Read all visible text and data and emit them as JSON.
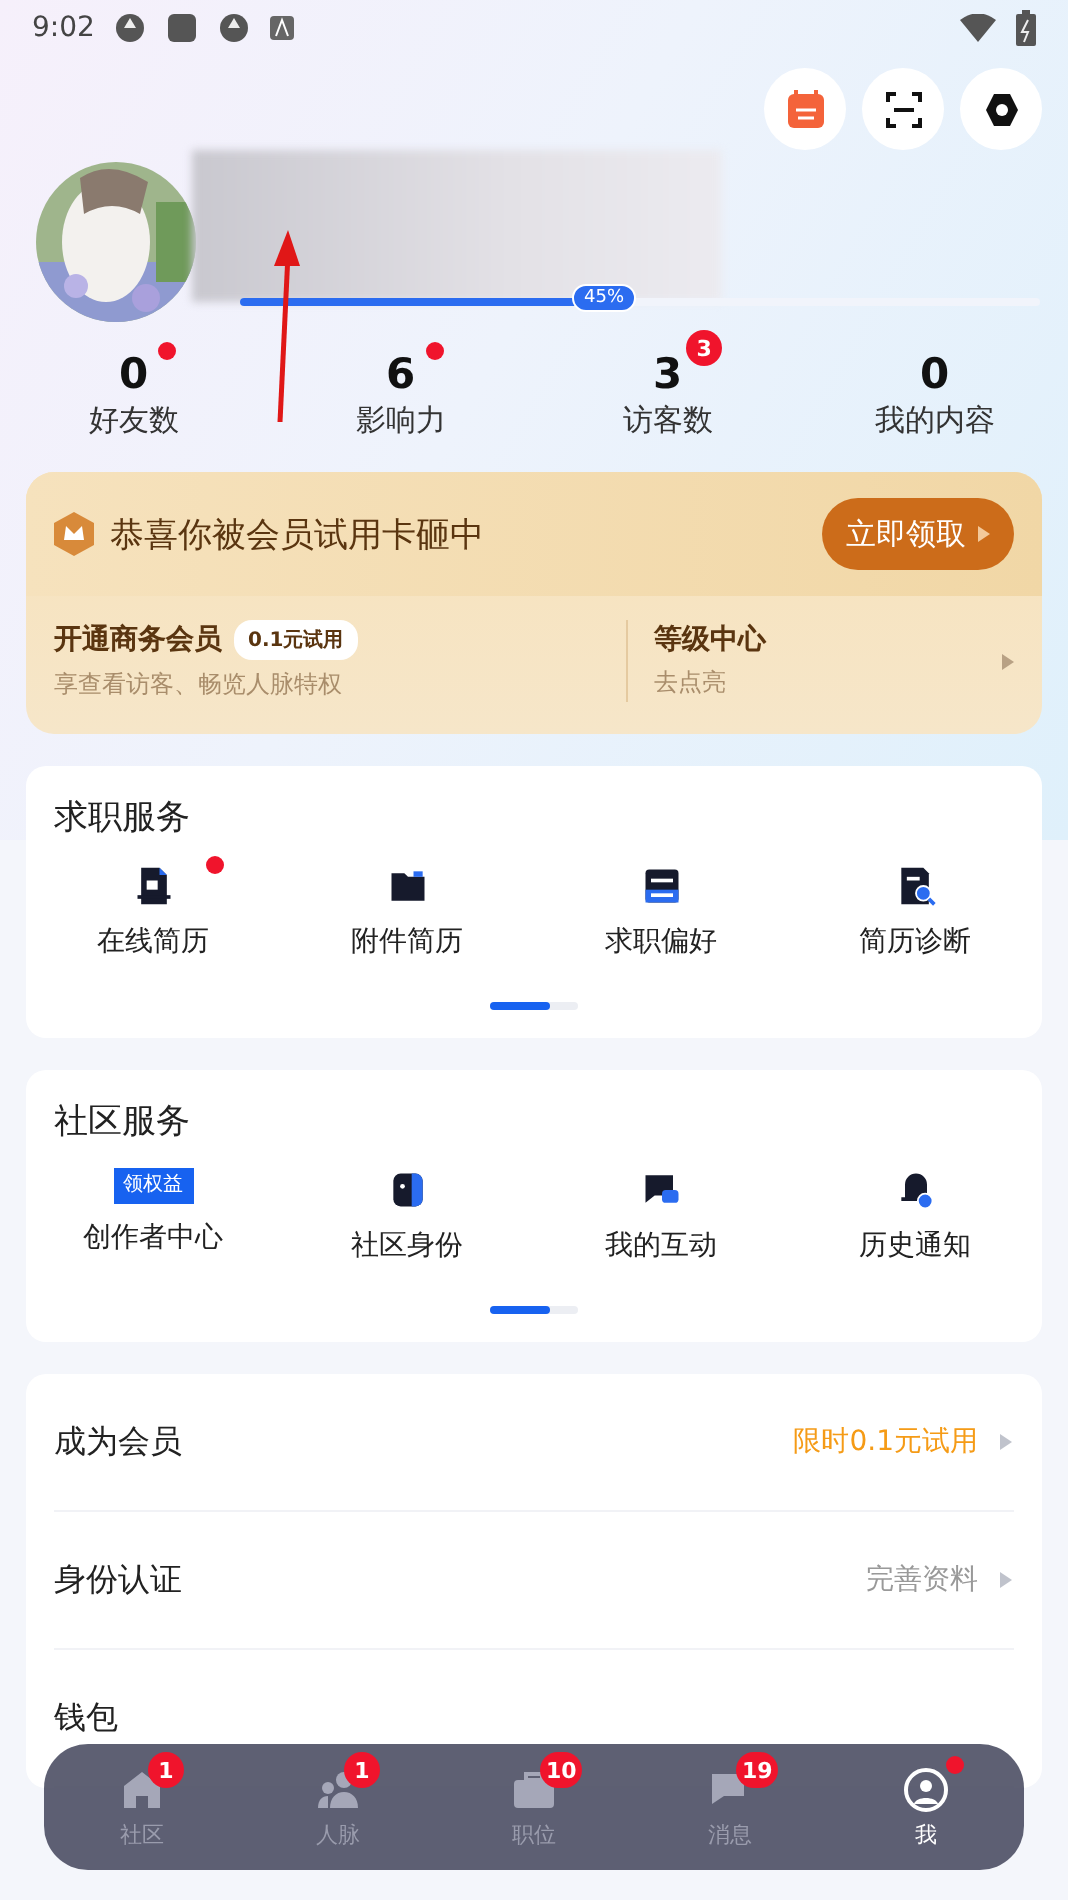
{
  "status_bar": {
    "time": "9:02"
  },
  "profile": {
    "progress": {
      "level": 0.45,
      "label": "45%"
    }
  },
  "stats": [
    {
      "value": "0",
      "label": "好友数",
      "dot": true
    },
    {
      "value": "6",
      "label": "影响力",
      "dot": true
    },
    {
      "value": "3",
      "label": "访客数",
      "dot": false,
      "badge": "3"
    },
    {
      "value": "0",
      "label": "我的内容",
      "dot": false
    }
  ],
  "member_card": {
    "title": "恭喜你被会员试用卡砸中",
    "button": "立即领取",
    "left_title": "开通商务会员",
    "left_tag": "0.1元试用",
    "left_sub": "享查看访客、畅览人脉特权",
    "right_title": "等级中心",
    "right_sub": "去点亮"
  },
  "sections": [
    {
      "title": "求职服务",
      "items": [
        {
          "label": "在线简历",
          "dot": true
        },
        {
          "label": "附件简历",
          "dot": false
        },
        {
          "label": "求职偏好",
          "dot": false
        },
        {
          "label": "简历诊断",
          "dot": false
        }
      ]
    },
    {
      "title": "社区服务",
      "items": [
        {
          "label": "创作者中心",
          "tag": "领权益",
          "dot": false
        },
        {
          "label": "社区身份",
          "dot": false
        },
        {
          "label": "我的互动",
          "dot": false
        },
        {
          "label": "历史通知",
          "dot": false
        }
      ]
    }
  ],
  "list": [
    {
      "label": "成为会员",
      "value": "限时0.1元试用",
      "highlight": true
    },
    {
      "label": "身份认证",
      "value": "完善资料",
      "highlight": false
    },
    {
      "label": "钱包"
    }
  ],
  "nav": [
    {
      "label": "社区",
      "badge": "1",
      "selected": false
    },
    {
      "label": "人脉",
      "badge": "1",
      "selected": false
    },
    {
      "label": "职位",
      "badge": "10",
      "selected": false
    },
    {
      "label": "消息",
      "badge": "19",
      "selected": false
    },
    {
      "label": "我",
      "selected": true
    }
  ]
}
